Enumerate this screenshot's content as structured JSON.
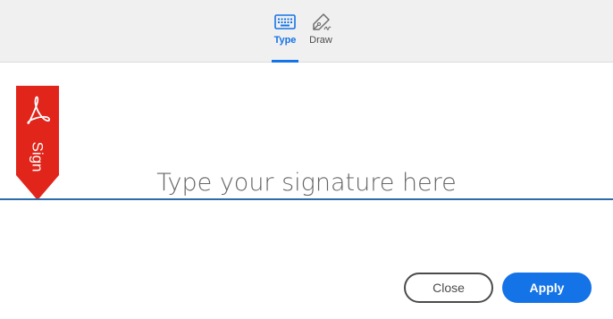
{
  "tabs": {
    "type": {
      "label": "Type",
      "icon": "keyboard-icon",
      "selected": true
    },
    "draw": {
      "label": "Draw",
      "icon": "pen-icon",
      "selected": false
    }
  },
  "sign_flag": {
    "label": "Sign",
    "icon": "acrobat-icon",
    "color": "#e1251b"
  },
  "signature": {
    "placeholder": "Type your signature here",
    "value": ""
  },
  "buttons": {
    "close": "Close",
    "apply": "Apply"
  },
  "colors": {
    "accent": "#1473e6",
    "line": "#2d6ca8",
    "flag": "#e1251b"
  }
}
